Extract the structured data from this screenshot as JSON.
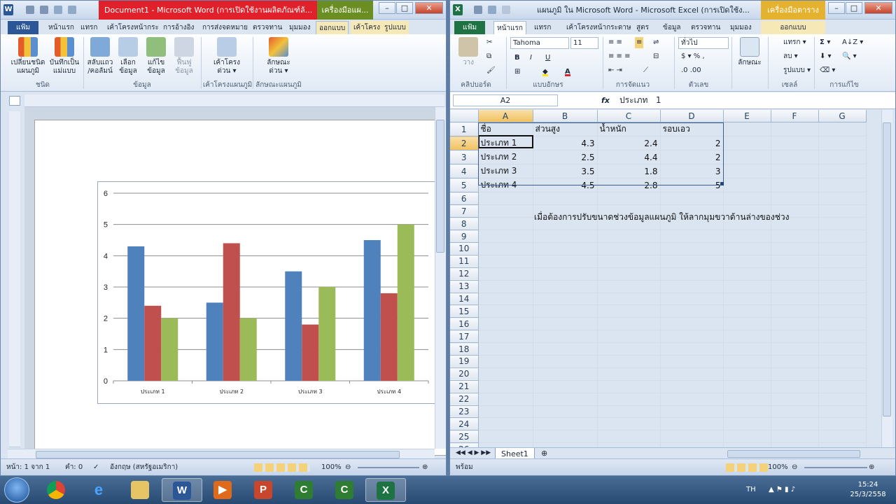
{
  "word": {
    "title": "Document1 - Microsoft Word (การเปิดใช้งานผลิตภัณฑ์ล้...",
    "context_tab_header": "เครื่องมือแผ...",
    "tabs": [
      "แฟ้ม",
      "หน้าแรก",
      "แทรก",
      "เค้าโครงหน้ากระ",
      "การอ้างอิง",
      "การส่งจดหมาย",
      "ตรวจทาน",
      "มุมมอง",
      "ออกแบบ",
      "เค้าโครง",
      "รูปแบบ"
    ],
    "ribbon": {
      "buttons": [
        "เปลี่ยนชนิด\nแผนภูมิ",
        "บันทึกเป็น\nแม่แบบ",
        "สลับแถว\n/คอลัมน์",
        "เลือก\nข้อมูล",
        "แก้ไข\nข้อมูล",
        "ฟื้นฟู\nข้อมูล",
        "เค้าโครง\nด่วน ▾",
        "ลักษณะ\nด่วน ▾"
      ],
      "groups": [
        "ชนิด",
        "ข้อมูล",
        "เค้าโครงแผนภูมิ",
        "ลักษณะแผนภูมิ"
      ]
    },
    "status": {
      "page": "หน้า: 1 จาก 1",
      "words": "คำ: 0",
      "language": "อังกฤษ (สหรัฐอเมริกา)",
      "zoom": "100%"
    }
  },
  "chart_data": {
    "type": "bar",
    "categories": [
      "ประเภท 1",
      "ประเภท 2",
      "ประเภท 3",
      "ประเภท 4"
    ],
    "series": [
      {
        "values": [
          4.3,
          2.5,
          3.5,
          4.5
        ],
        "color": "#4f81bd"
      },
      {
        "values": [
          2.4,
          4.4,
          1.8,
          2.8
        ],
        "color": "#c0504d"
      },
      {
        "values": [
          2,
          2,
          3,
          5
        ],
        "color": "#9bbb59"
      }
    ],
    "ylim": [
      0,
      6
    ],
    "yticks": [
      "0",
      "1",
      "2",
      "3",
      "4",
      "5",
      "6"
    ],
    "grid": true
  },
  "excel": {
    "title": "แผนภูมิ ใน Microsoft Word - Microsoft Excel (การเปิดใช้ง...",
    "context_tab_header": "เครื่องมือตาราง",
    "tabs": [
      "แฟ้ม",
      "หน้าแรก",
      "แทรก",
      "เค้าโครงหน้ากระดาษ",
      "สูตร",
      "ข้อมูล",
      "ตรวจทาน",
      "มุมมอง",
      "ออกแบบ"
    ],
    "ribbon": {
      "font_name": "Tahoma",
      "font_size": "11",
      "number_format": "ทั่วไป",
      "insert": "แทรก ▾",
      "delete": "ลบ ▾",
      "format": "รูปแบบ ▾",
      "styles": "ลักษณะ",
      "paste": "วาง",
      "groups": [
        "คลิปบอร์ด",
        "แบบอักษร",
        "การจัดแนว",
        "ตัวเลข",
        "เซลล์",
        "การแก้ไข"
      ]
    },
    "name_box": "A2",
    "formula": "ประเภท   1",
    "columns": [
      "A",
      "B",
      "C",
      "D",
      "E",
      "F",
      "G"
    ],
    "rows": [
      [
        "ชื่อ",
        "ส่วนสูง",
        "น้ำหนัก",
        "รอบเอว"
      ],
      [
        "ประเภท 1",
        "4.3",
        "2.4",
        "2"
      ],
      [
        "ประเภท 2",
        "2.5",
        "4.4",
        "2"
      ],
      [
        "ประเภท 3",
        "3.5",
        "1.8",
        "3"
      ],
      [
        "ประเภท 4",
        "4.5",
        "2.8",
        "5"
      ]
    ],
    "note": "เมื่อต้องการปรับขนาดช่วงข้อมูลแผนภูมิ ให้ลากมุมขวาด้านล่างของช่วง",
    "sheet_tab": "Sheet1",
    "status": "พร้อม",
    "zoom": "100%"
  },
  "taskbar": {
    "lang": "TH",
    "time": "15:24",
    "date": "25/3/2558"
  }
}
